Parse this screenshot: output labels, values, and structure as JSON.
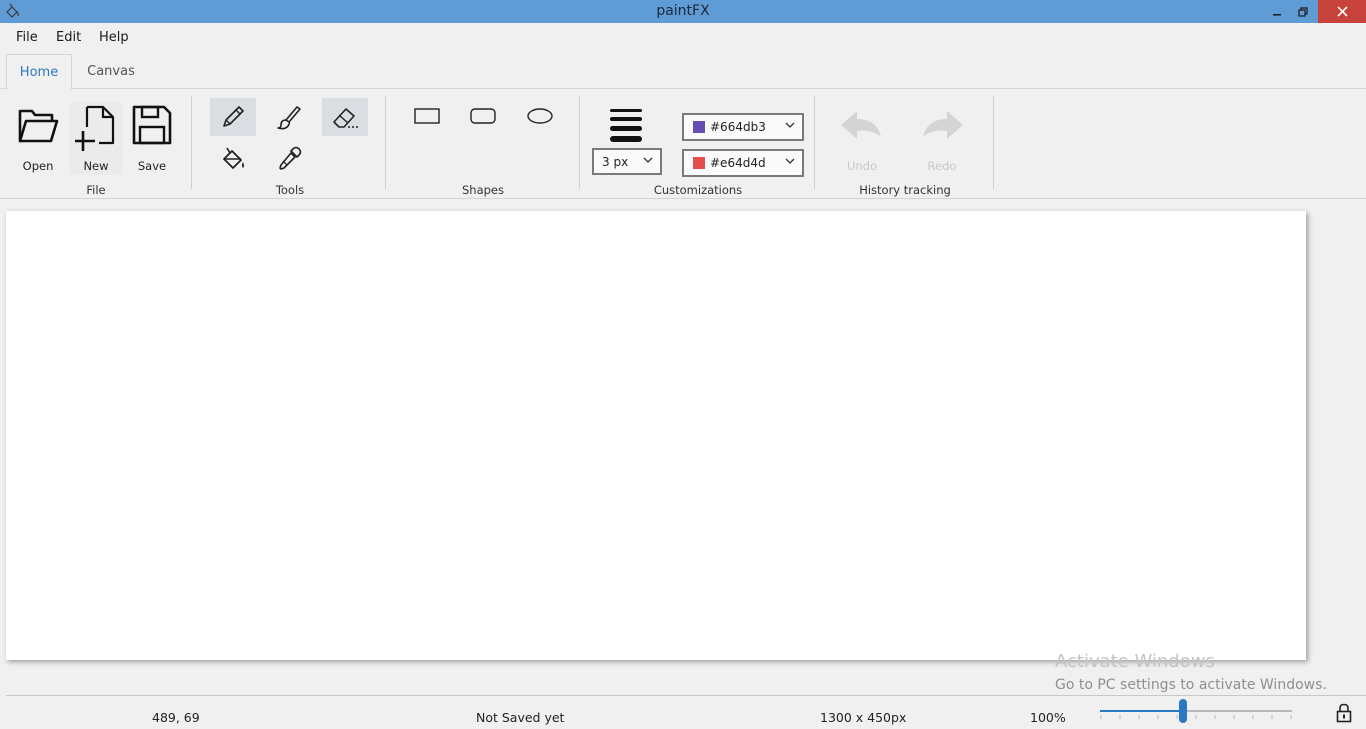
{
  "window": {
    "title": "paintFX",
    "icons": {
      "app": "paint-bucket-app-icon",
      "minimize": "minimize-icon",
      "maximize": "restore-icon",
      "close": "close-icon"
    }
  },
  "menu": {
    "file": "File",
    "edit": "Edit",
    "help": "Help"
  },
  "tabs": {
    "home": "Home",
    "canvas": "Canvas"
  },
  "ribbon": {
    "file_group": {
      "label": "File",
      "open": "Open",
      "new": "New",
      "save": "Save"
    },
    "tools_group": {
      "label": "Tools",
      "tools": [
        "pencil-icon",
        "brush-icon",
        "eraser-icon",
        "fill-bucket-icon",
        "color-picker-icon"
      ],
      "selected": [
        "pencil-icon",
        "eraser-icon"
      ]
    },
    "shapes_group": {
      "label": "Shapes",
      "shapes": [
        "rectangle-icon",
        "rounded-rectangle-icon",
        "ellipse-icon"
      ]
    },
    "customizations_group": {
      "label": "Customizations",
      "stroke_size": "3 px",
      "primary_color": "#664db3",
      "secondary_color": "#e64d4d"
    },
    "history_group": {
      "label": "History tracking",
      "undo": "Undo",
      "redo": "Redo"
    }
  },
  "status": {
    "cursor": "489, 69",
    "save_state": "Not Saved yet",
    "canvas_size": "1300 x 450px",
    "zoom": "100%",
    "zoom_slider_fraction": 0.43
  },
  "watermark": {
    "line1": "Activate Windows",
    "line2": "Go to PC settings to activate Windows."
  },
  "colors": {
    "titlebar": "#5f9bd4",
    "accent": "#2b78c2",
    "close": "#c7423a"
  }
}
